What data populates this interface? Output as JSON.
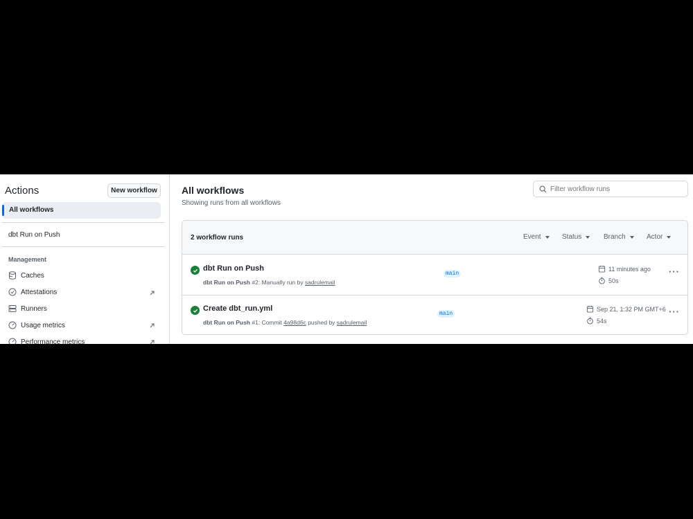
{
  "sidebar": {
    "title": "Actions",
    "new_workflow_label": "New workflow",
    "active_item": "All workflows",
    "workflows": [
      "dbt Run on Push"
    ],
    "section_label": "Management",
    "management": [
      {
        "label": "Caches",
        "icon": "database-icon",
        "external": false
      },
      {
        "label": "Attestations",
        "icon": "check-circle-icon",
        "external": true
      },
      {
        "label": "Runners",
        "icon": "server-icon",
        "external": false
      },
      {
        "label": "Usage metrics",
        "icon": "gauge-icon",
        "external": true
      },
      {
        "label": "Performance metrics",
        "icon": "gauge-icon",
        "external": true
      }
    ]
  },
  "header": {
    "title": "All workflows",
    "subtitle": "Showing runs from all workflows",
    "filter_placeholder": "Filter workflow runs"
  },
  "runs": {
    "count_label": "2 workflow runs",
    "filters": [
      "Event",
      "Status",
      "Branch",
      "Actor"
    ],
    "items": [
      {
        "title": "dbt Run on Push",
        "workflow": "dbt Run on Push",
        "run_number": "#2",
        "meta_text": ": Manually run by ",
        "commit": "",
        "meta_tail": "",
        "actor": "sadrulemail",
        "branch": "main",
        "time": "11 minutes ago",
        "duration": "50s",
        "status": "success"
      },
      {
        "title": "Create dbt_run.yml",
        "workflow": "dbt Run on Push",
        "run_number": "#1",
        "meta_text": ": Commit ",
        "commit": "4a98d6c",
        "meta_tail": " pushed by ",
        "actor": "sadrulemail",
        "branch": "main",
        "time": "Sep 21, 1:32 PM GMT+6",
        "duration": "54s",
        "status": "success"
      }
    ]
  },
  "colors": {
    "accent": "#0969da",
    "success": "#1a7f37",
    "border": "#d0d7de"
  }
}
